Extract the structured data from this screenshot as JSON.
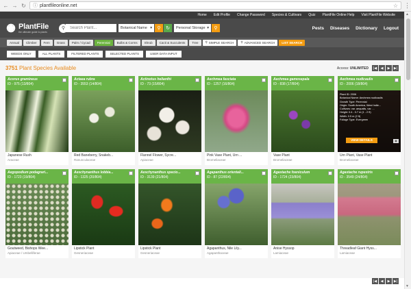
{
  "browser": {
    "url": "plantfileonline.net"
  },
  "toplinks": [
    "Home",
    "Edit Profile",
    "Change Password",
    "Species & Cultivars",
    "Quiz",
    "PlantFile Online Help",
    "Visit PlantFile Website"
  ],
  "header": {
    "logo": "PlantFile",
    "tagline": "the ultimate guide to plants",
    "search_placeholder": "Search Plant...",
    "search_type": "Botanical Name",
    "storage": "Personal Storage",
    "nav": [
      "Pests",
      "Diseases",
      "Dictionary",
      "Logout"
    ]
  },
  "filters": [
    "Annual",
    "Climber",
    "Fern",
    "Grass",
    "Palm / Cycad",
    "Perennial",
    "Bulbs & Corms",
    "Shrub",
    "Cacti & Succulents",
    "Tree"
  ],
  "active_filter": "Perennial",
  "simple_search": "SIMPLE SEARCH",
  "advanced_search": "ADVANCED SEARCH",
  "list_search": "LIST SEARCH",
  "views": [
    "WEEDS ONLY",
    "ALL PLANTS",
    "FILTERED PLANTS",
    "SELECTED PLANTS",
    "USER DATA INPUT"
  ],
  "info": {
    "count": "3751",
    "count_suffix": " Plant Species Available",
    "access_label": "Access: ",
    "access_value": "UNLIMITED"
  },
  "cards": [
    {
      "sp": "Acorus gramineus",
      "id": "ID - 975 (13/804)",
      "cn": "Japanese Rush",
      "fam": "Araceae"
    },
    {
      "sp": "Actaea rubra",
      "id": "ID - 3553 (14/804)",
      "cn": "Red Baneberry, Snakeb...",
      "fam": "Ranunculaceae"
    },
    {
      "sp": "Actinotus helianthi",
      "id": "ID - 73 (15/804)",
      "cn": "Flannel Flower, Sycre...",
      "fam": "Apiaceae"
    },
    {
      "sp": "Aechmea fasciata",
      "id": "ID - 1257 (16/804)",
      "cn": "Pink Vase Plant, Urn ...",
      "fam": "Bromeliaceae"
    },
    {
      "sp": "Aechmea gamosepala",
      "id": "ID - 838 (17/804)",
      "cn": "Vase Plant",
      "fam": "Bromeliaceae"
    },
    {
      "sp": "Aechmea nudicaulis",
      "id": "ID - 2006 (18/804)",
      "cn": "Urn Plant, Vase Plant",
      "fam": "Bromeliaceae"
    },
    {
      "sp": "Aegopodium podagrari...",
      "id": "ID - 1723 (19/804)",
      "cn": "Goutweed, Bishops Wee...",
      "fam": "Apiaceae / Umbelliferae"
    },
    {
      "sp": "Aeschynanthus lobbia...",
      "id": "ID - 1325 (20/804)",
      "cn": "Lipstick Plant",
      "fam": "Gesneriaceae"
    },
    {
      "sp": "Aeschynanthus specio...",
      "id": "ID - 3139 (21/804)",
      "cn": "Lipstick Plant",
      "fam": "Gesneriaceae"
    },
    {
      "sp": "Agapanthus orientali...",
      "id": "ID - 87 (22/804)",
      "cn": "Agapanthus, Nile Lily...",
      "fam": "Agapanthaceae"
    },
    {
      "sp": "Agastache foeniculum",
      "id": "ID - 1724 (23/804)",
      "cn": "Anise Hyssop",
      "fam": "Lamiaceae"
    },
    {
      "sp": "Agastache rupestris",
      "id": "ID - 3549 (24/804)",
      "cn": "Threadleaf Giant Hyss...",
      "fam": "Lamiaceae"
    }
  ],
  "overlay": {
    "plant_id": "Plant ID: 2006",
    "botanical": "Botanical Name: Aechmea nudicaulis",
    "growth": "Growth Type: Perennial",
    "origin": "Origin: South America, West Indie...",
    "cultivars": "Cultivars: var. aequalis, var. ...",
    "height": "Height: 0.4 - 0.7 m (1 - 2 ft)",
    "width": "Width: 0.5 m (2 ft)",
    "foliage": "Foliage Type: Evergreen",
    "button": "VIEW DETAILS"
  }
}
